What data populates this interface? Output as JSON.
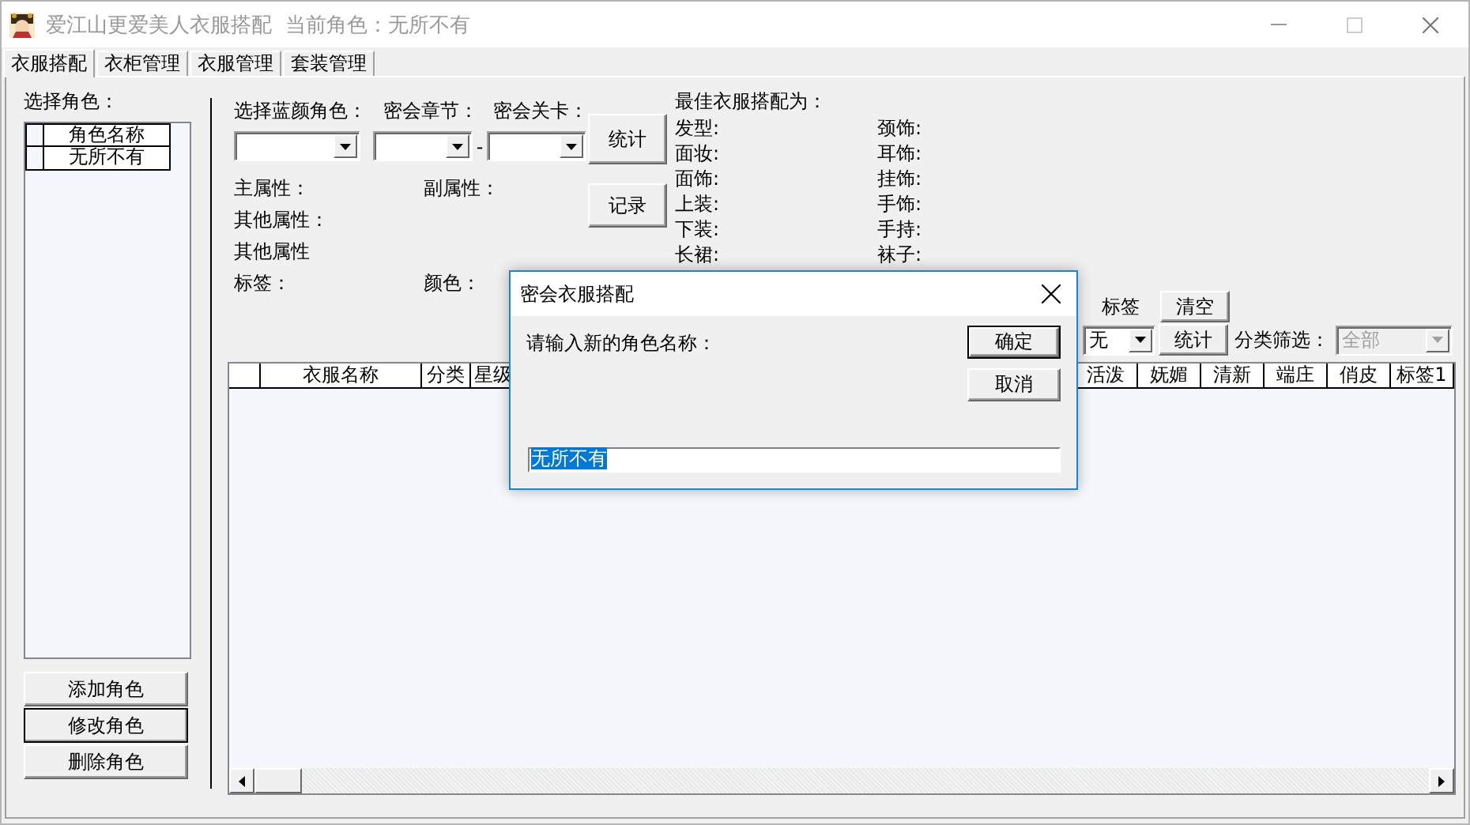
{
  "window": {
    "title": "爱江山更爱美人衣服搭配  当前角色：无所不有",
    "active": false
  },
  "tabs": [
    {
      "label": "衣服搭配",
      "selected": true
    },
    {
      "label": "衣柜管理",
      "selected": false
    },
    {
      "label": "衣服管理",
      "selected": false
    },
    {
      "label": "套装管理",
      "selected": false
    }
  ],
  "role_panel": {
    "label": "选择角色：",
    "list": {
      "column": "角色名称",
      "rows": [
        "无所不有"
      ]
    },
    "buttons": [
      {
        "label": "添加角色",
        "focused": false
      },
      {
        "label": "修改角色",
        "focused": true
      },
      {
        "label": "删除角色",
        "focused": false
      }
    ]
  },
  "selectors": {
    "labels": [
      "选择蓝颜角色：",
      "密会章节：",
      "密会关卡："
    ],
    "range_separator": "-",
    "buttons": [
      "统计",
      "记录"
    ]
  },
  "attributes": [
    {
      "left": "主属性：",
      "right": "副属性："
    },
    {
      "left": "其他属性："
    },
    {
      "left": "其他属性"
    },
    {
      "left": "标签：",
      "right": "颜色："
    }
  ],
  "best_outfit": {
    "title": "最佳衣服搭配为：",
    "slots": [
      {
        "left": "发型:",
        "right": "颈饰:"
      },
      {
        "left": "面妆:",
        "right": "耳饰:"
      },
      {
        "left": "面饰:",
        "right": "挂饰:"
      },
      {
        "left": "上装:",
        "right": "手饰:"
      },
      {
        "left": "下装:",
        "right": "手持:"
      },
      {
        "left": "长裙:",
        "right": "袜子:"
      }
    ]
  },
  "tag_filter": {
    "label": "标签",
    "clear_button": "清空",
    "tag_value": "无",
    "count_button": "统计",
    "category_label": "分类筛选：",
    "category_value": "全部",
    "category_disabled": true
  },
  "table": {
    "columns": [
      {
        "label": "衣服名称"
      },
      {
        "label": "分类"
      },
      {
        "label": "星级",
        "stretch": true
      },
      {
        "label": "活泼"
      },
      {
        "label": "妩媚"
      },
      {
        "label": "清新"
      },
      {
        "label": "端庄"
      },
      {
        "label": "俏皮"
      },
      {
        "label": "标签1"
      }
    ]
  },
  "dialog": {
    "title": "密会衣服搭配",
    "prompt": "请输入新的角色名称：",
    "value": "无所不有",
    "value_selected": true,
    "buttons": [
      {
        "label": "确定",
        "default": true
      },
      {
        "label": "取消",
        "default": false
      }
    ]
  }
}
